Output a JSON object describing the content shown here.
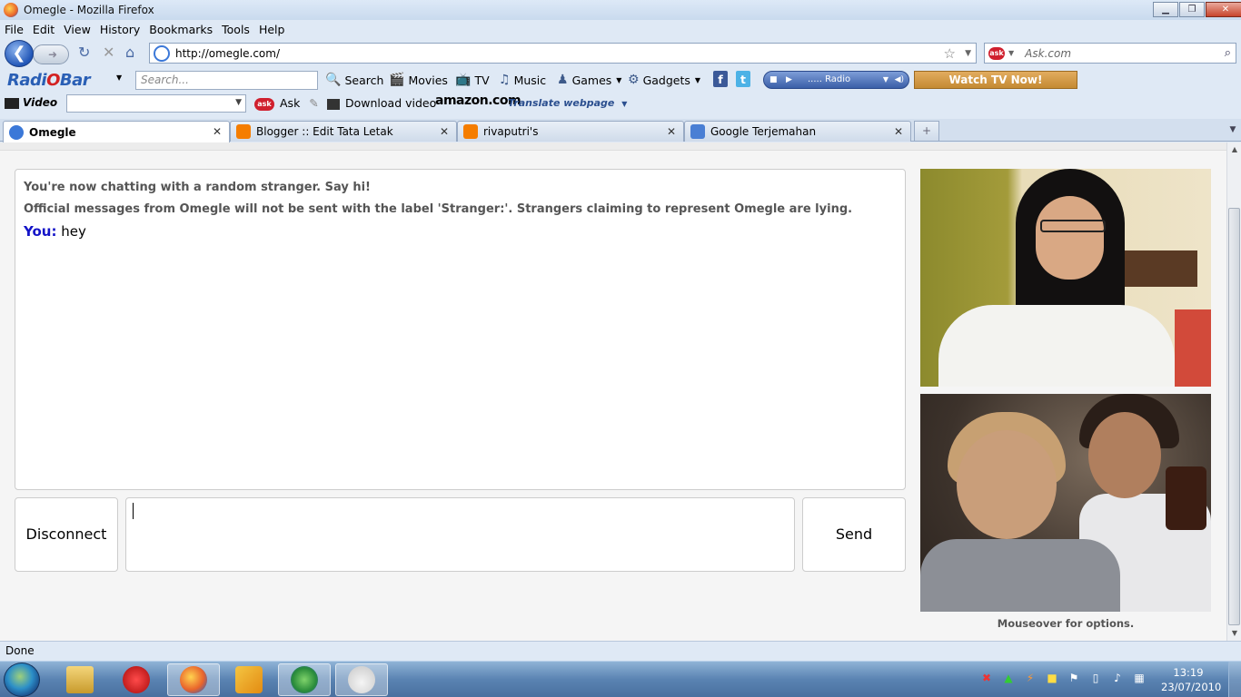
{
  "window": {
    "title": "Omegle - Mozilla Firefox",
    "min": "▁",
    "max": "❐",
    "close": "✕"
  },
  "menu": [
    "File",
    "Edit",
    "View",
    "History",
    "Bookmarks",
    "Tools",
    "Help"
  ],
  "nav": {
    "url": "http://omegle.com/",
    "search_placeholder": "Ask.com"
  },
  "radiobar": {
    "logo_left": "Radi",
    "logo_o": "O",
    "logo_right": "Bar",
    "search_placeholder": "Search...",
    "search_btn": "Search",
    "items": [
      "Movies",
      "TV",
      "Music",
      "Games",
      "Gadgets"
    ],
    "radio_label": "..... Radio",
    "watch_tv": "Watch TV Now!"
  },
  "toolbar2": {
    "video_label": "Video",
    "ask_label": "Ask",
    "download_label": "Download video",
    "amazon": "amazon.com",
    "translate": "Translate webpage"
  },
  "tabs": [
    {
      "label": "Omegle",
      "active": true,
      "color": "#3b78d8"
    },
    {
      "label": "Blogger :: Edit Tata Letak",
      "active": false,
      "color": "#f57d00"
    },
    {
      "label": "rivaputri's",
      "active": false,
      "color": "#f57d00"
    },
    {
      "label": "Google Terjemahan",
      "active": false,
      "color": "#4a7fd4"
    }
  ],
  "chat": {
    "system_1": "You're now chatting with a random stranger. Say hi!",
    "system_2": "Official messages from Omegle will not be sent with the label 'Stranger:'. Strangers claiming to represent Omegle are lying.",
    "you_label": "You:",
    "you_message": "hey",
    "disconnect": "Disconnect",
    "send": "Send",
    "input_value": ""
  },
  "video_hint": "Mouseover for options.",
  "status": "Done",
  "clock": {
    "time": "13:19",
    "date": "23/07/2010"
  }
}
